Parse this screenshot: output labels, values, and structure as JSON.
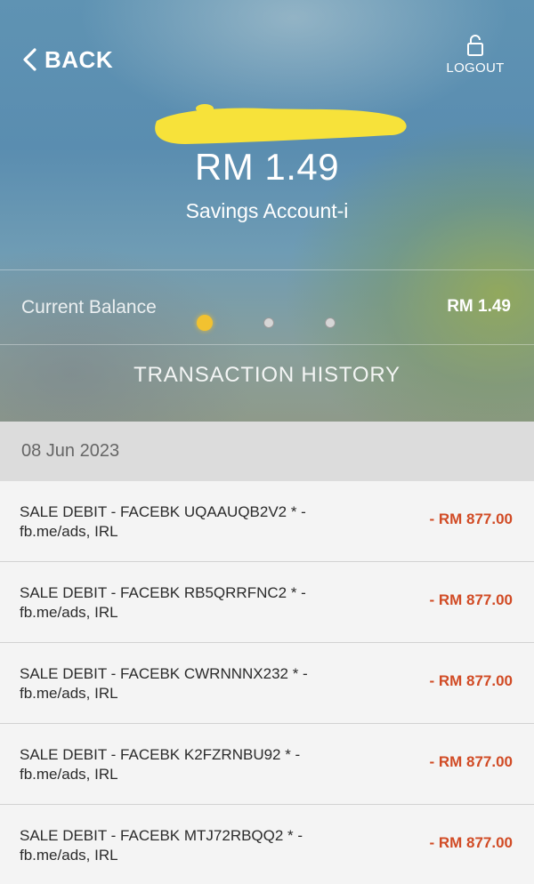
{
  "header": {
    "back_label": "BACK",
    "logout_label": "LOGOUT"
  },
  "account": {
    "amount": "RM 1.49",
    "type": "Savings Account-i"
  },
  "balance": {
    "label": "Current Balance",
    "value": "RM 1.49",
    "pager_active_index": 0,
    "pager_count": 3
  },
  "history": {
    "title": "TRANSACTION HISTORY",
    "date": "08 Jun 2023",
    "transactions": [
      {
        "line1": "SALE DEBIT - FACEBK UQAAUQB2V2 * -",
        "line2": "fb.me/ads, IRL",
        "amount": "- RM 877.00"
      },
      {
        "line1": "SALE DEBIT - FACEBK RB5QRRFNC2 * -",
        "line2": "fb.me/ads, IRL",
        "amount": "- RM 877.00"
      },
      {
        "line1": "SALE DEBIT - FACEBK CWRNNNX232 * -",
        "line2": "fb.me/ads, IRL",
        "amount": "- RM 877.00"
      },
      {
        "line1": "SALE DEBIT - FACEBK K2FZRNBU92 * -",
        "line2": "fb.me/ads, IRL",
        "amount": "- RM 877.00"
      },
      {
        "line1": "SALE DEBIT - FACEBK MTJ72RBQQ2 * -",
        "line2": "fb.me/ads, IRL",
        "amount": "- RM 877.00"
      }
    ]
  },
  "colors": {
    "debit_amount": "#d14b25",
    "pager_active": "#f2c230",
    "redaction_highlight": "#f7e23a"
  }
}
